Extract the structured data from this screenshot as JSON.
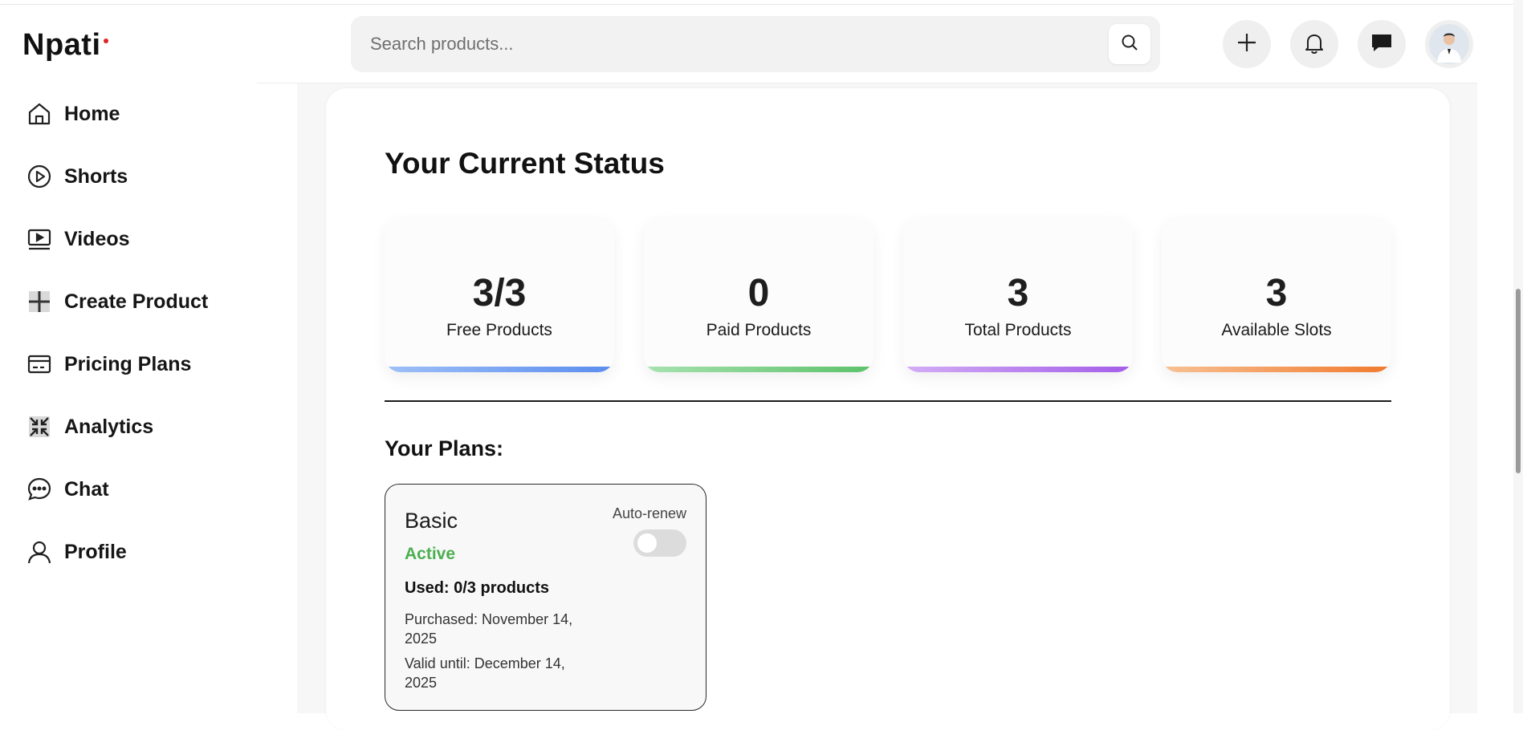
{
  "app": {
    "logo": "Npati",
    "accent": "#e02424"
  },
  "sidebar": {
    "items": [
      {
        "label": "Home",
        "icon": "home-icon"
      },
      {
        "label": "Shorts",
        "icon": "play-circle-icon"
      },
      {
        "label": "Videos",
        "icon": "video-icon"
      },
      {
        "label": "Create Product",
        "icon": "plus-icon"
      },
      {
        "label": "Pricing Plans",
        "icon": "card-icon"
      },
      {
        "label": "Analytics",
        "icon": "analytics-icon"
      },
      {
        "label": "Chat",
        "icon": "chat-icon"
      },
      {
        "label": "Profile",
        "icon": "user-icon"
      }
    ]
  },
  "header": {
    "search_placeholder": "Search products...",
    "actions": [
      "plus-icon",
      "bell-icon",
      "message-icon",
      "avatar"
    ]
  },
  "status": {
    "title": "Your Current Status",
    "stats": [
      {
        "value": "3/3",
        "label": "Free Products",
        "color": "#5b8def"
      },
      {
        "value": "0",
        "label": "Paid Products",
        "color": "#5cc26a"
      },
      {
        "value": "3",
        "label": "Total Products",
        "color": "#a35de8"
      },
      {
        "value": "3",
        "label": "Available Slots",
        "color": "#f07a2e"
      }
    ]
  },
  "plans": {
    "title": "Your Plans:",
    "items": [
      {
        "name": "Basic",
        "status": "Active",
        "status_color": "#4caf50",
        "used": "Used: 0/3 products",
        "purchased": "Purchased: November 14, 2025",
        "valid_until": "Valid until: December 14, 2025",
        "auto_renew_label": "Auto-renew",
        "auto_renew": false
      }
    ]
  }
}
